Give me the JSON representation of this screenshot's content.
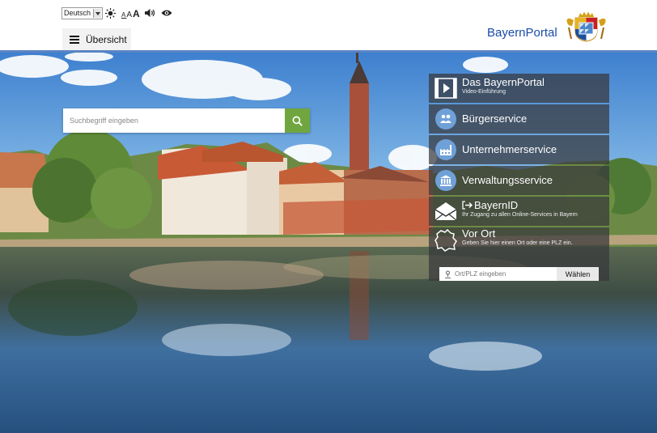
{
  "header": {
    "language": "Deutsch",
    "font_size_labels": [
      "A",
      "A",
      "A"
    ],
    "menu_label": "Übersicht",
    "brand": "BayernPortal"
  },
  "search": {
    "placeholder": "Suchbegriff eingeben"
  },
  "services": [
    {
      "title": "Das BayernPortal",
      "subtitle": "Video-Einführung",
      "icon": "video-icon"
    },
    {
      "title": "Bürgerservice",
      "subtitle": "",
      "icon": "people-icon"
    },
    {
      "title": "Unternehmerservice",
      "subtitle": "",
      "icon": "factory-icon"
    },
    {
      "title": "Verwaltungsservice",
      "subtitle": "",
      "icon": "building-icon"
    },
    {
      "title": "BayernID",
      "subtitle": "Ihr Zugang zu allen Online-Services in Bayern",
      "icon": "envelope-icon"
    },
    {
      "title": "Vor Ort",
      "subtitle": "Geben Sie hier einen Ort oder eine PLZ ein.",
      "icon": "bavaria-map-icon"
    }
  ],
  "location": {
    "placeholder": "Ort/PLZ eingeben",
    "button": "Wählen"
  },
  "colors": {
    "brand_blue": "#1a4ba6",
    "search_green": "#70a640",
    "panel_bg": "#37373c",
    "service_circle": "#6fa0d8"
  }
}
